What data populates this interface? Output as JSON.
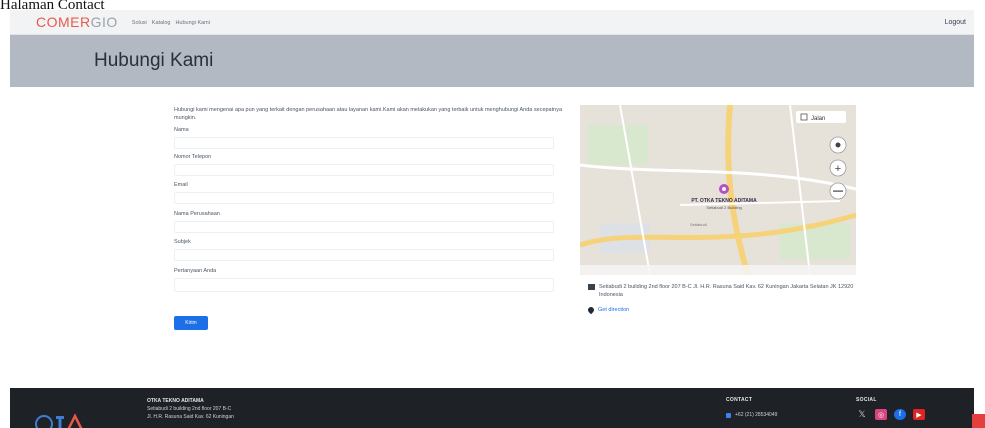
{
  "caption": "Halaman Contact",
  "navbar": {
    "brand_main": "COMER",
    "brand_accent": "GIO",
    "links": [
      "Solusi",
      "Katalog",
      "Hubungi Kami"
    ],
    "logout": "Logout"
  },
  "hero": {
    "title": "Hubungi Kami"
  },
  "form": {
    "intro": "Hubungi kami mengenai apa pun yang terkait dengan perusahaan atau layanan kami.Kami akan melakukan yang terbaik untuk menghubungi Anda secepatnya mungkin.",
    "fields": [
      {
        "label": "Nama",
        "value": ""
      },
      {
        "label": "Nomor Telepon",
        "value": ""
      },
      {
        "label": "Email",
        "value": ""
      },
      {
        "label": "Nama Perusahaan",
        "value": ""
      },
      {
        "label": "Subjek",
        "value": ""
      },
      {
        "label": "Pertanyaan Anda",
        "value": ""
      }
    ],
    "submit": "Kirim"
  },
  "map": {
    "marker_title": "PT. OTKA TEKNO ADITAMA",
    "marker_sub": "Setiabudi 2 Building",
    "layer_label": "Jalan",
    "street_label": "Setiabudi"
  },
  "address": {
    "text": "Setiabudi 2 building 2nd floor 207 B-C Jl. H.R. Rasuna Said Kav. 62 Kuningan Jakarta Selatan JK 12920 Indonesia",
    "direction": "Get direction"
  },
  "footer": {
    "company": "OTKA TEKNO ADITAMA",
    "addr_line1": "Setiabudi 2 building 2nd floor 207 B-C",
    "addr_line2": "Jl. H.R. Rasuna Said Kav. 62 Kuningan",
    "contact_heading": "CONTACT",
    "phone": "+62 (21) 28534049",
    "social_heading": "SOCIAL",
    "social_icons": [
      "x-icon",
      "instagram-icon",
      "facebook-icon",
      "youtube-icon"
    ],
    "logo_text": "OTKA"
  },
  "colors": {
    "brand": "#e8594a",
    "accent": "#1d6fe8",
    "hero_bg": "#b3b9c2",
    "footer_bg": "#1e2126"
  }
}
